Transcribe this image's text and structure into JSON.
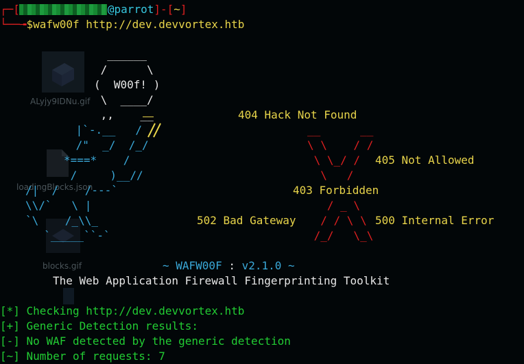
{
  "prompt": {
    "bracket_open": "[",
    "at_host": "@parrot",
    "sep": "]-[",
    "dir": "~",
    "bracket_close": "]",
    "corner": "└──╼",
    "command": "$wafw00f http://dev.devvortex.htb"
  },
  "desktop_icons": [
    {
      "label": "ALyjy9IDNu.gif"
    },
    {
      "label": "loadingBlocks.json"
    },
    {
      "label": "blocks.gif"
    }
  ],
  "ascii_art": {
    "bubble": "  ______\n /      \\\n(  W00f! )\n \\  ____/\n ,,    __",
    "dog_lines": [
      " |`-.__   / /",
      " /\"  _/  /_/",
      "*===*    /",
      " /     )__//",
      "/|  /    /---`",
      "\\\\/`   \\ |",
      "`\\    /_\\\\_",
      "  `_____``-`"
    ],
    "x_lines": [
      "__      __",
      "\\ \\    / /",
      " \\ \\_/ /",
      "  \\   /",
      "   / _ \\",
      "  / / \\ \\",
      " /_/   \\_\\"
    ]
  },
  "labels": {
    "hack_not_found": "404 Hack Not Found",
    "not_allowed": "405 Not Allowed",
    "forbidden": "403 Forbidden",
    "bad_gateway": "502 Bad Gateway",
    "internal_error": "500 Internal Error"
  },
  "banner": {
    "tilde_left": "~ ",
    "name": "WAFW00F",
    "colon": " : ",
    "version": "v2.1.0",
    "tilde_right": " ~",
    "tagline": "The Web Application Firewall Fingerprinting Toolkit"
  },
  "output": [
    {
      "tag": "[*]",
      "text": " Checking http://dev.devvortex.htb"
    },
    {
      "tag": "[+]",
      "text": " Generic Detection results:"
    },
    {
      "tag": "[-]",
      "text": " No WAF detected by the generic detection"
    },
    {
      "tag": "[~]",
      "text": " Number of requests: 7"
    }
  ],
  "colors": {
    "red": "#e02020",
    "green": "#22cc33",
    "yellow": "#e8d44a",
    "cyan": "#3aa8d8",
    "white": "#e8e8e8"
  }
}
